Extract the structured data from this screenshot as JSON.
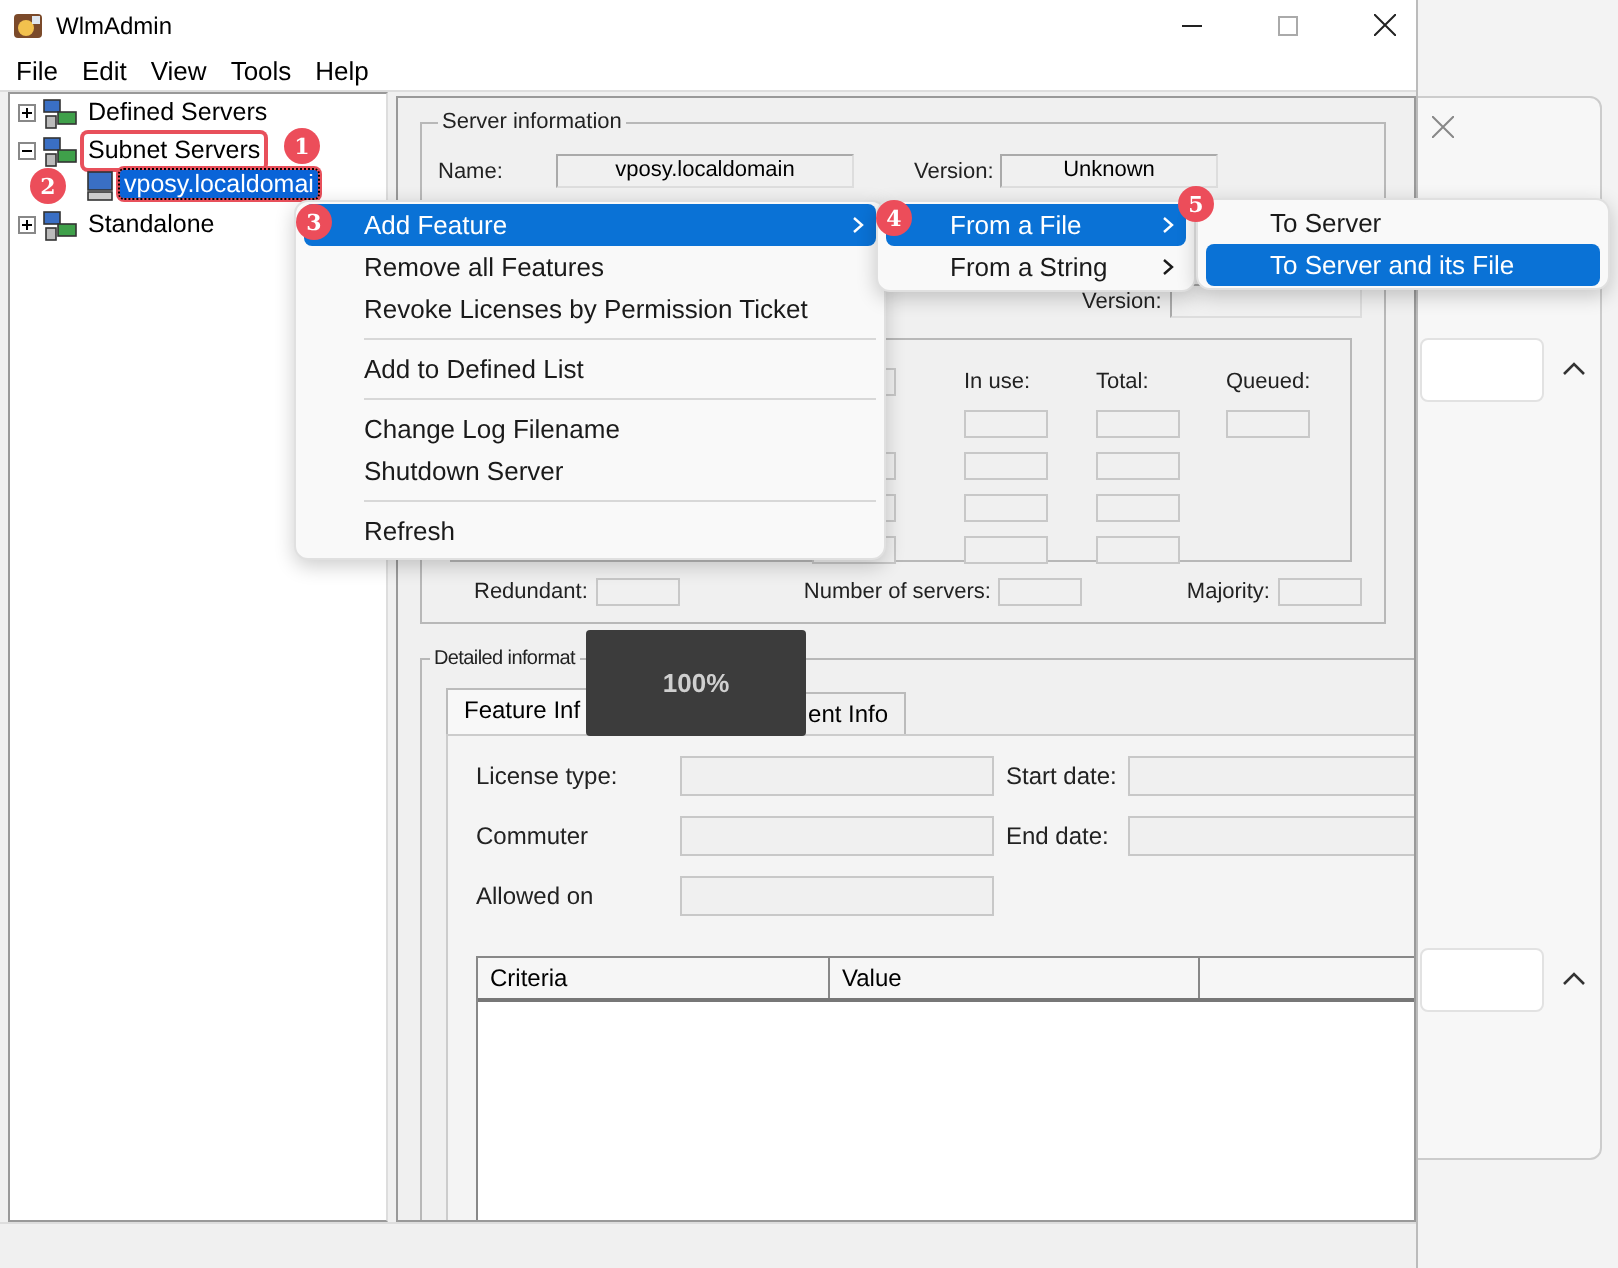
{
  "window": {
    "title": "WlmAdmin"
  },
  "menu_bar": [
    "File",
    "Edit",
    "View",
    "Tools",
    "Help"
  ],
  "tree": [
    {
      "label": "Defined Servers",
      "expanded": false,
      "selected": false,
      "marked": false
    },
    {
      "label": "Subnet Servers",
      "expanded": true,
      "selected": false,
      "marked": true,
      "children": [
        {
          "label": "vposy.localdomai",
          "selected": true,
          "marked": true
        }
      ]
    },
    {
      "label": "Standalone",
      "expanded": false,
      "selected": false,
      "marked": false
    }
  ],
  "server_information": {
    "title": "Server information",
    "name_label": "Name:",
    "name_value": "vposy.localdomain",
    "version_label": "Version:",
    "version_value": "Unknown",
    "version2_label": "Version:",
    "columns": [
      "In use:",
      "Total:",
      "Queued:"
    ],
    "footer": [
      "Redundant:",
      "Number of servers:",
      "Majority:"
    ]
  },
  "detailed_information": {
    "title": "Detailed informat",
    "tabs": [
      {
        "label": "Feature Inf",
        "selected": true
      },
      {
        "label": "ent Info",
        "selected": false
      }
    ],
    "fields": [
      {
        "label": "License type:"
      },
      {
        "label": "Start date:"
      },
      {
        "label": "Commuter"
      },
      {
        "label": "End date:"
      },
      {
        "label": "Allowed on"
      }
    ],
    "table": {
      "columns": [
        "Criteria",
        "Value"
      ]
    }
  },
  "progress_toast": {
    "text": "100%"
  },
  "context_menu": [
    {
      "kind": "item",
      "label": "Add Feature",
      "selected": true,
      "submenu": true
    },
    {
      "kind": "item",
      "label": "Remove all Features",
      "selected": false,
      "submenu": false
    },
    {
      "kind": "item",
      "label": "Revoke Licenses by Permission Ticket",
      "selected": false,
      "submenu": false
    },
    {
      "kind": "separator"
    },
    {
      "kind": "item",
      "label": "Add to Defined List",
      "selected": false,
      "submenu": false
    },
    {
      "kind": "separator"
    },
    {
      "kind": "item",
      "label": "Change Log Filename",
      "selected": false,
      "submenu": false
    },
    {
      "kind": "item",
      "label": "Shutdown Server",
      "selected": false,
      "submenu": false
    },
    {
      "kind": "separator"
    },
    {
      "kind": "item",
      "label": "Refresh",
      "selected": false,
      "submenu": false
    }
  ],
  "submenu": [
    {
      "label": "From a File",
      "selected": true,
      "submenu": true
    },
    {
      "label": "From a String",
      "selected": false,
      "submenu": true
    }
  ],
  "submenu_2": [
    {
      "label": "To Server",
      "selected": false
    },
    {
      "label": "To Server and its File",
      "selected": true
    }
  ],
  "step_badges": [
    "1",
    "2",
    "3",
    "4",
    "5"
  ]
}
